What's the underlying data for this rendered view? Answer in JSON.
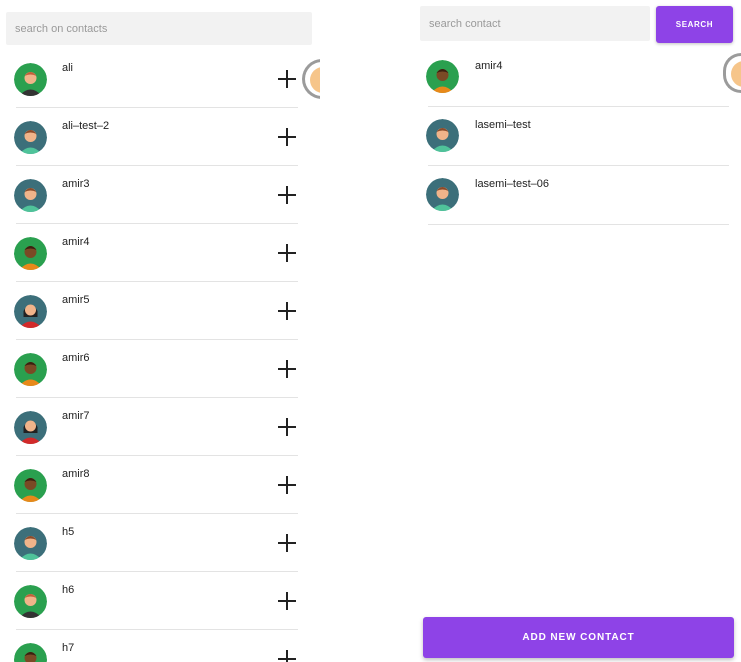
{
  "left": {
    "search_placeholder": "search on contacts",
    "contacts": [
      {
        "name": "ali",
        "avatar": "person-avatar-icon"
      },
      {
        "name": "ali–test–2",
        "avatar": "person-avatar-icon"
      },
      {
        "name": "amir3",
        "avatar": "person-avatar-icon"
      },
      {
        "name": "amir4",
        "avatar": "person-avatar-icon"
      },
      {
        "name": "amir5",
        "avatar": "person-avatar-icon"
      },
      {
        "name": "amir6",
        "avatar": "person-avatar-icon"
      },
      {
        "name": "amir7",
        "avatar": "person-avatar-icon"
      },
      {
        "name": "amir8",
        "avatar": "person-avatar-icon"
      },
      {
        "name": "h5",
        "avatar": "person-avatar-icon"
      },
      {
        "name": "h6",
        "avatar": "person-avatar-icon"
      },
      {
        "name": "h7",
        "avatar": "person-avatar-icon"
      }
    ],
    "add_icon": "plus-icon"
  },
  "right": {
    "search_placeholder": "search contact",
    "search_label": "SEARCH",
    "contacts": [
      {
        "name": "amir4"
      },
      {
        "name": "lasemi–test"
      },
      {
        "name": "lasemi–test–06"
      }
    ],
    "add_contact_label": "ADD NEW CONTACT"
  },
  "colors": {
    "accent": "#8e43e7",
    "avatar_green": "#2aa04f",
    "avatar_teal": "#3c6f7a"
  }
}
